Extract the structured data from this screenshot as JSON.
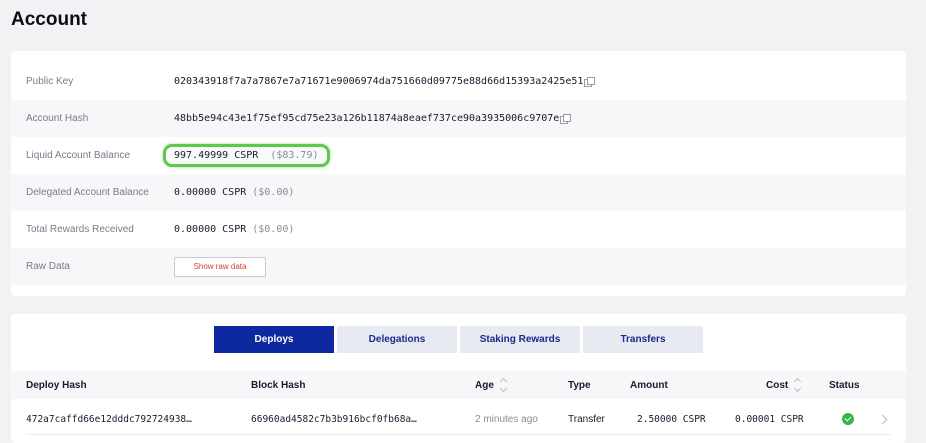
{
  "page": {
    "title": "Account"
  },
  "info": {
    "public_key": {
      "label": "Public Key",
      "value": "020343918f7a7a7867e7a71671e9006974da751660d09775e88d66d15393a2425e51"
    },
    "account_hash": {
      "label": "Account Hash",
      "value": "48bb5e94c43e1f75ef95cd75e23a126b11874a8eaef737ce90a3935006c9707e"
    },
    "liquid_balance": {
      "label": "Liquid Account Balance",
      "amount": "997.49999 CSPR",
      "fiat": "($83.79)"
    },
    "delegated_balance": {
      "label": "Delegated Account Balance",
      "amount": "0.00000 CSPR",
      "fiat": "($0.00)"
    },
    "total_rewards": {
      "label": "Total Rewards Received",
      "amount": "0.00000 CSPR",
      "fiat": "($0.00)"
    },
    "raw_data": {
      "label": "Raw Data",
      "button": "Show raw data"
    }
  },
  "tabs": [
    {
      "label": "Deploys",
      "active": true
    },
    {
      "label": "Delegations",
      "active": false
    },
    {
      "label": "Staking Rewards",
      "active": false
    },
    {
      "label": "Transfers",
      "active": false
    }
  ],
  "table": {
    "columns": [
      "Deploy Hash",
      "Block Hash",
      "Age",
      "Type",
      "Amount",
      "Cost",
      "Status"
    ],
    "rows": [
      {
        "deploy_hash": "472a7caffd66e12dddc792724938…",
        "block_hash": "66960ad4582c7b3b916bcf0fb68a…",
        "age": "2 minutes ago",
        "type": "Transfer",
        "amount": "2.50000 CSPR",
        "cost": "0.00001 CSPR",
        "status": "success"
      }
    ]
  },
  "colors": {
    "accent": "#0e28a0",
    "highlight": "#5cc94a",
    "success": "#2db84d",
    "danger": "#d63a2a"
  },
  "icons": [
    "copy-icon",
    "sort-icon",
    "status-success-icon",
    "chevron-right-icon"
  ]
}
